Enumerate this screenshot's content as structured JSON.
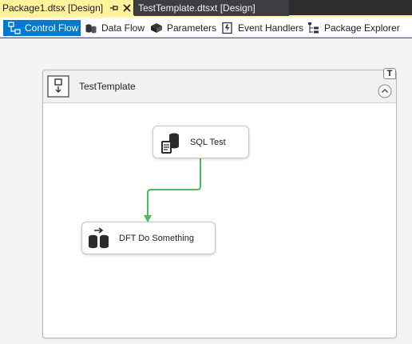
{
  "document_tabs": {
    "active_label": "Package1.dtsx [Design]",
    "inactive_label": "TestTemplate.dtsxt [Design]"
  },
  "designer_tabs": [
    {
      "label": "Control Flow",
      "icon": "control-flow-icon",
      "active": true
    },
    {
      "label": "Data Flow",
      "icon": "data-flow-icon",
      "active": false
    },
    {
      "label": "Parameters",
      "icon": "parameters-icon",
      "active": false
    },
    {
      "label": "Event Handlers",
      "icon": "event-handlers-icon",
      "active": false
    },
    {
      "label": "Package Explorer",
      "icon": "package-explorer-icon",
      "active": false
    }
  ],
  "container": {
    "title": "TestTemplate",
    "tag": "T"
  },
  "tasks": [
    {
      "label": "SQL Test",
      "icon": "execute-sql-task-icon"
    },
    {
      "label": "DFT Do Something",
      "icon": "data-flow-task-icon"
    }
  ],
  "colors": {
    "active_doc_tab": "#fff29d",
    "accent": "#007acc",
    "precedence_success": "#4cba60"
  }
}
